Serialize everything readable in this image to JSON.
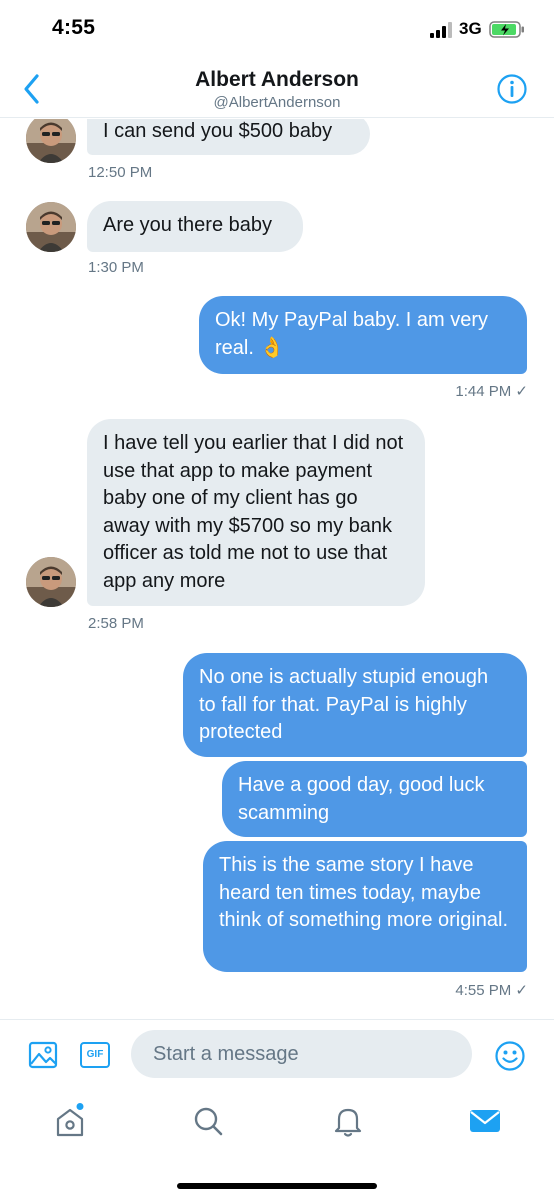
{
  "status_bar": {
    "time": "4:55",
    "network": "3G"
  },
  "header": {
    "name": "Albert Anderson",
    "handle": "@AlbertAndernson"
  },
  "messages": [
    {
      "text": "I can send you $500 baby",
      "time": "12:50 PM"
    },
    {
      "text": "Are you there baby",
      "time": "1:30 PM"
    },
    {
      "text": "Ok! My PayPal baby. I am very real. 👌",
      "time": "1:44 PM ✓"
    },
    {
      "text": "I have tell you earlier that I did not use that app to make payment baby one of my client has go away with my $5700 so my bank officer as  told me not to use that app any more",
      "time": "2:58 PM"
    },
    {
      "text": "No one is actually stupid enough to fall for that. PayPal is highly protected"
    },
    {
      "text": "Have a good day, good luck scamming"
    },
    {
      "text": "This is the same story I have heard ten times today, maybe think of something more original.",
      "time": "4:55 PM ✓"
    }
  ],
  "composer": {
    "gif_label": "GIF",
    "placeholder": "Start a message"
  },
  "colors": {
    "accent": "#1da1f2",
    "outgoing_bubble": "#4f98e6",
    "incoming_bubble": "#e6ecf0",
    "muted_text": "#657786"
  },
  "icons": {
    "back": "chevron-left-icon",
    "info": "info-icon",
    "image": "image-icon",
    "emoji": "smiley-icon",
    "tabs": [
      "home-icon",
      "search-icon",
      "bell-icon",
      "mail-icon"
    ]
  }
}
